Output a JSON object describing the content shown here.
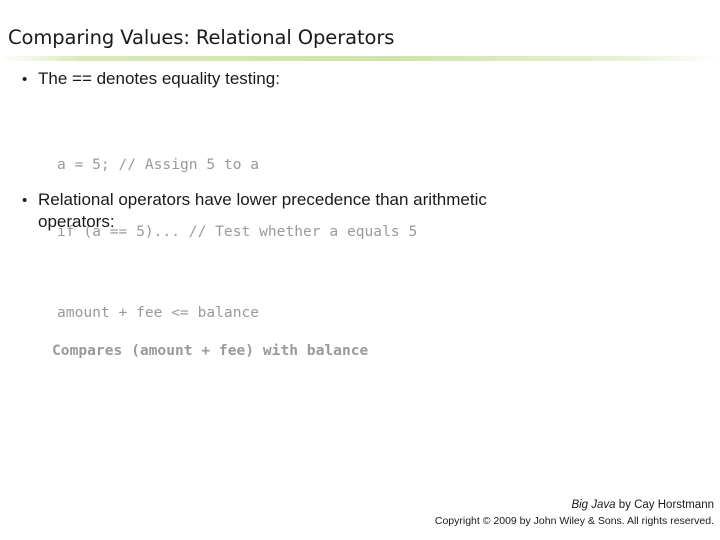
{
  "slide": {
    "title": "Comparing Values: Relational Operators",
    "bullets": [
      {
        "marker": "•",
        "text": "The == denotes equality testing:"
      },
      {
        "marker": "•",
        "text": "Relational operators have lower precedence than arithmetic",
        "continuation": "operators:"
      }
    ],
    "code_blocks": [
      {
        "line1": "a = 5; // Assign 5 to a",
        "line2": "if (a == 5)... // Test whether a equals 5"
      },
      {
        "line1": "amount + fee <= balance"
      },
      {
        "line1": "Compares (amount + fee) with balance"
      }
    ],
    "footer": {
      "book_title": "Big Java",
      "author_credit": " by Cay Horstmann",
      "copyright": "Copyright © 2009 by John Wiley & Sons.  All rights reserved."
    }
  }
}
